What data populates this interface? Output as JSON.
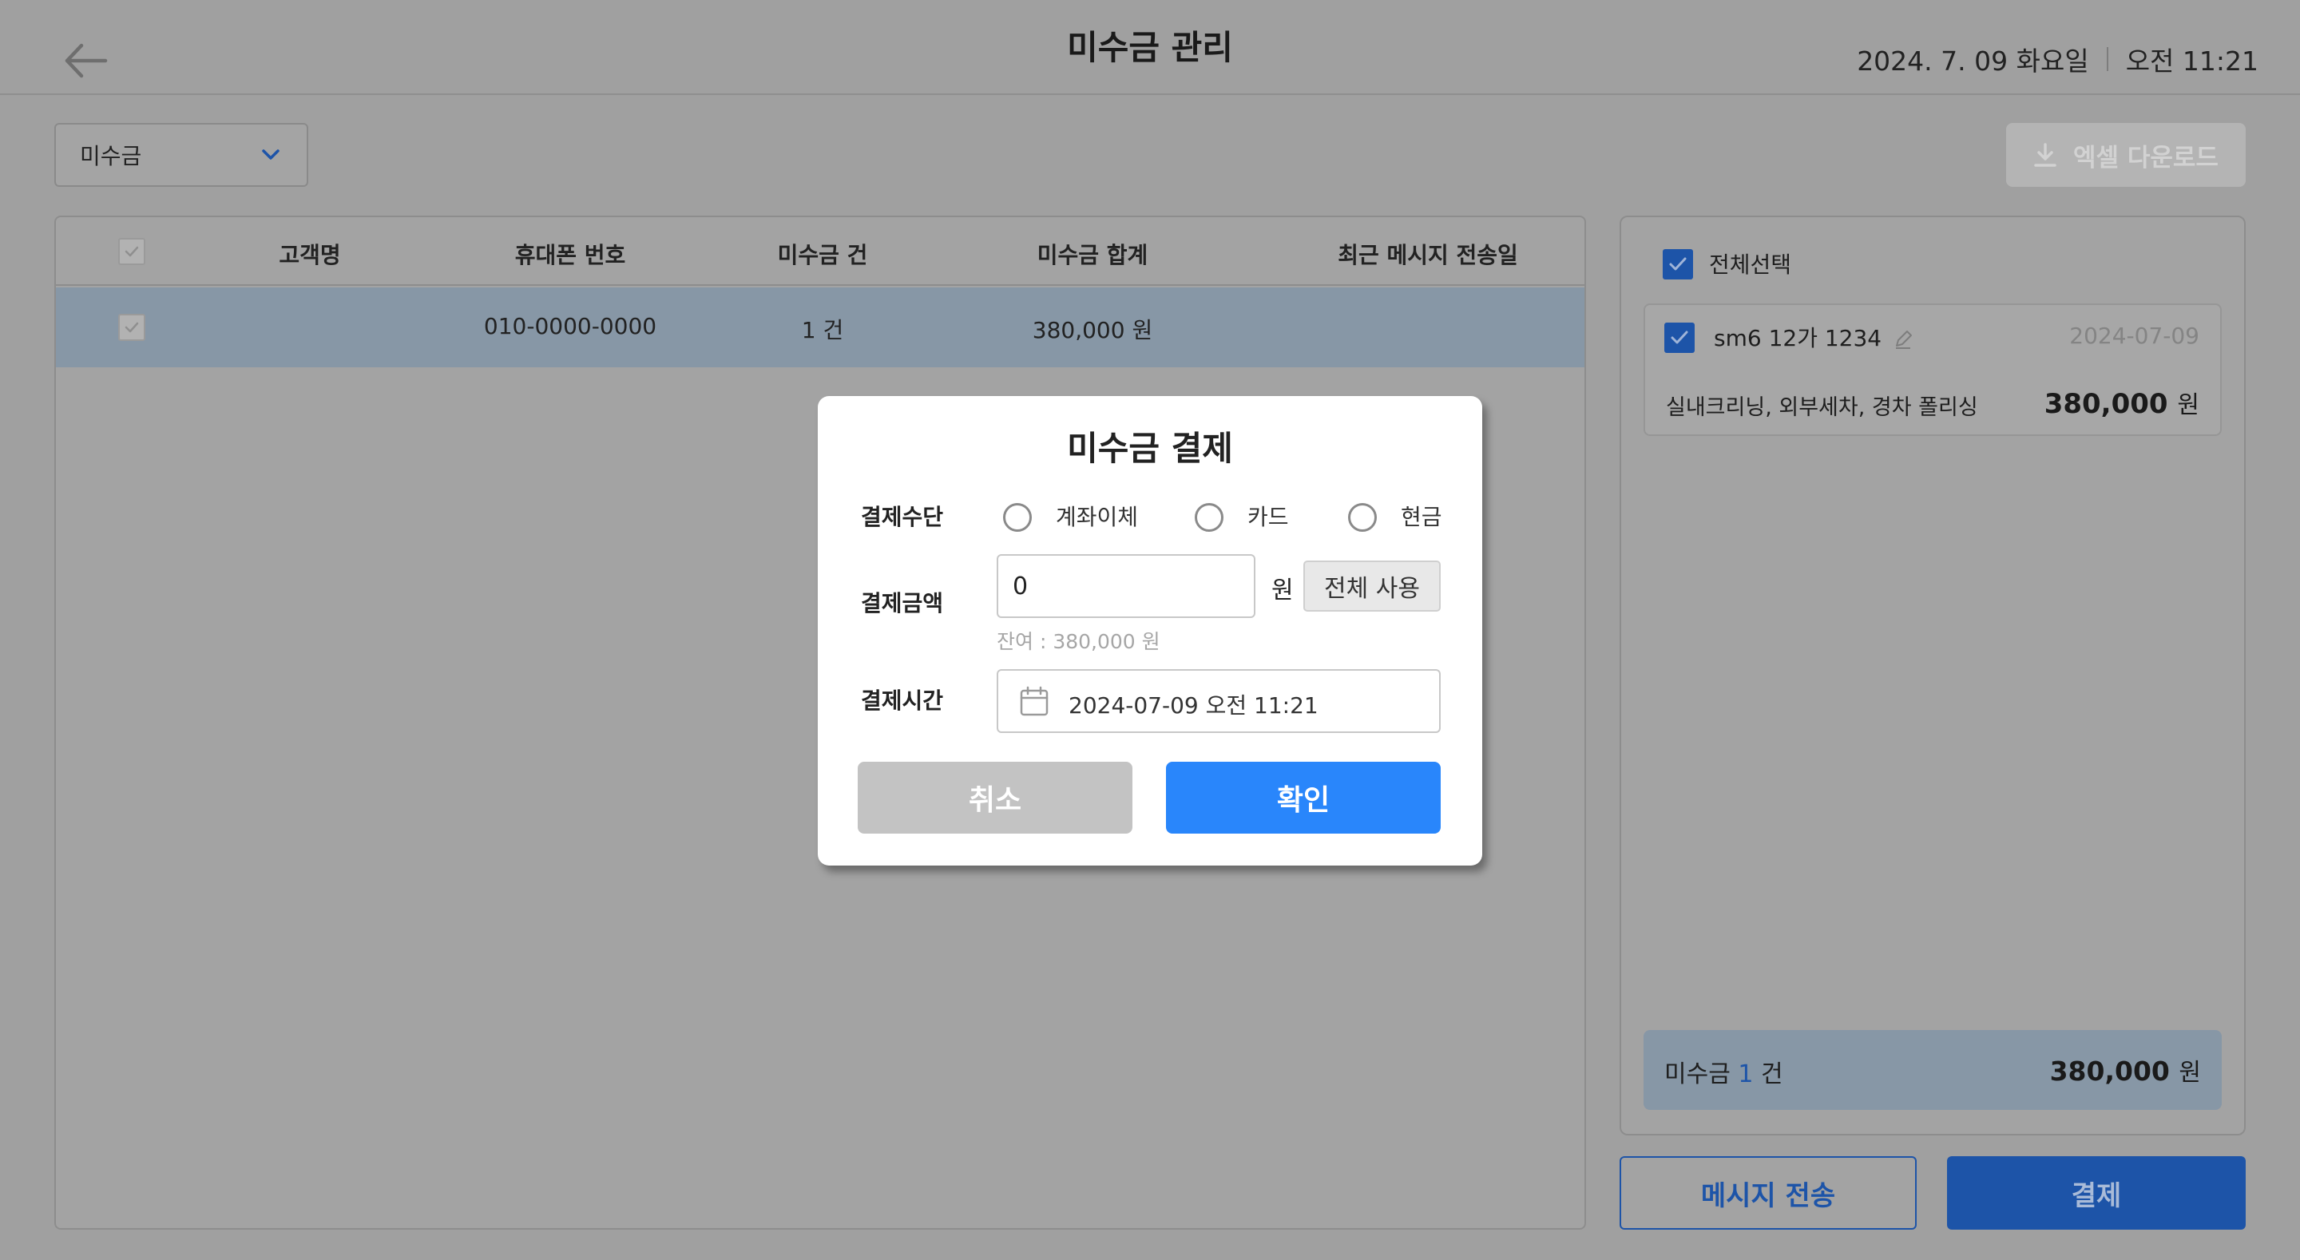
{
  "header": {
    "title": "미수금 관리",
    "date": "2024. 7. 09 화요일",
    "time": "오전 11:21"
  },
  "filter": {
    "selected": "미수금"
  },
  "toolbar": {
    "excel_label": "엑셀 다운로드"
  },
  "table": {
    "columns": [
      "고객명",
      "휴대폰 번호",
      "미수금 건",
      "미수금 합계",
      "최근 메시지 전송일"
    ],
    "rows": [
      {
        "name": "",
        "phone": "010-0000-0000",
        "count": "1 건",
        "total": "380,000 원",
        "last_sent": ""
      }
    ]
  },
  "side": {
    "select_all_label": "전체선택",
    "items": [
      {
        "car": "sm6 12가 1234",
        "date": "2024-07-09",
        "services": "실내크리닝, 외부세차, 경차 폴리싱",
        "amount": "380,000",
        "unit": "원"
      }
    ],
    "summary": {
      "label": "미수금",
      "count": "1",
      "count_unit": "건",
      "amount": "380,000",
      "unit": "원"
    }
  },
  "actions": {
    "message_label": "메시지 전송",
    "pay_label": "결제"
  },
  "modal": {
    "title": "미수금 결제",
    "method_label": "결제수단",
    "methods": [
      "계좌이체",
      "카드",
      "현금"
    ],
    "amount_label": "결제금액",
    "amount_value": "0",
    "amount_unit": "원",
    "use_all_label": "전체 사용",
    "remaining": "잔여 : 380,000 원",
    "time_label": "결제시간",
    "time_value": "2024-07-09 오전 11:21",
    "cancel_label": "취소",
    "confirm_label": "확인"
  },
  "colors": {
    "primary": "#2986fb",
    "brand_dark": "#1d54a8",
    "overlay": "#a0a0a0",
    "selected_row": "#8797a6"
  }
}
